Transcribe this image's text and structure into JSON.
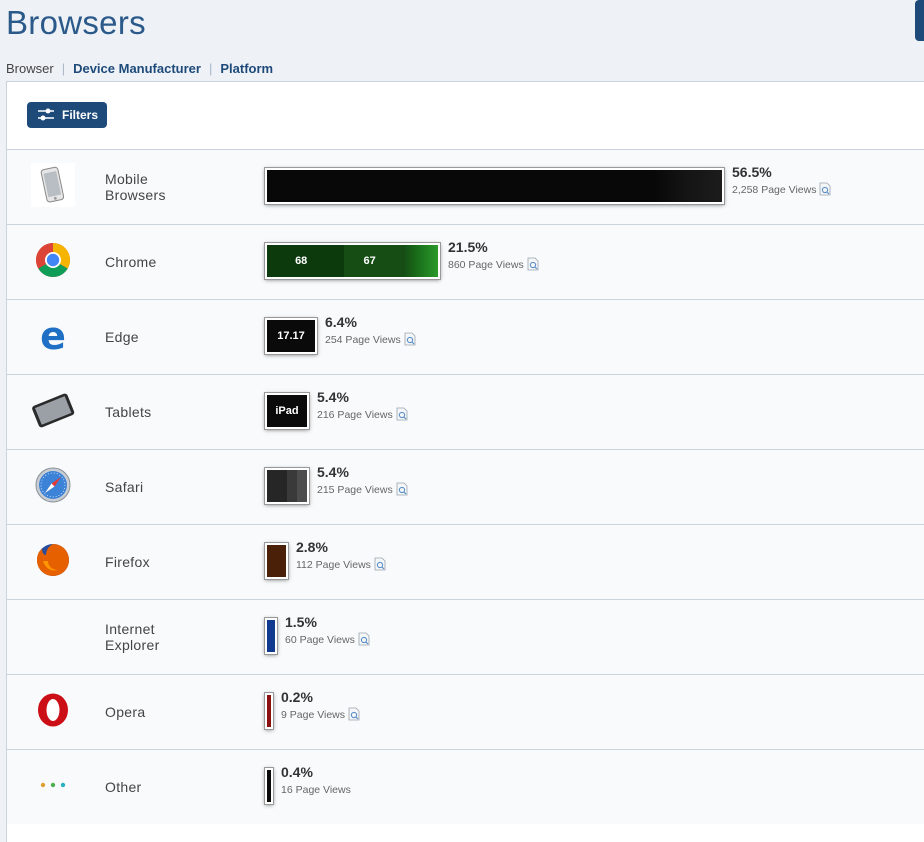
{
  "page": {
    "title": "Browsers"
  },
  "tabs": [
    {
      "label": "Browser",
      "active": true
    },
    {
      "label": "Device Manufacturer",
      "active": false
    },
    {
      "label": "Platform",
      "active": false
    }
  ],
  "filters": {
    "label": "Filters"
  },
  "rows": [
    {
      "name_lines": [
        "Mobile",
        "Browsers"
      ],
      "percent": "56.5%",
      "views": "2,258 Page Views",
      "share": 56.5,
      "icon": "mobile-phone-icon",
      "bar_color": "#0a0a0a",
      "bar_labels": [],
      "has_report_icon": true
    },
    {
      "name_lines": [
        "Chrome"
      ],
      "percent": "21.5%",
      "views": "860 Page Views",
      "share": 21.5,
      "icon": "chrome-icon",
      "bar_color": "#0b3d0b",
      "bar_labels": [
        "68",
        "67"
      ],
      "has_report_icon": true
    },
    {
      "name_lines": [
        "Edge"
      ],
      "percent": "6.4%",
      "views": "254 Page Views",
      "share": 6.4,
      "icon": "edge-icon",
      "bar_color": "#0a0a0a",
      "bar_labels": [
        "17.17"
      ],
      "has_report_icon": true
    },
    {
      "name_lines": [
        "Tablets"
      ],
      "percent": "5.4%",
      "views": "216 Page Views",
      "share": 5.4,
      "icon": "tablet-icon",
      "bar_color": "#0a0a0a",
      "bar_labels": [
        "iPad"
      ],
      "has_report_icon": true
    },
    {
      "name_lines": [
        "Safari"
      ],
      "percent": "5.4%",
      "views": "215 Page Views",
      "share": 5.4,
      "icon": "safari-icon",
      "bar_color": "#2a2a2a",
      "bar_labels": [],
      "has_report_icon": true
    },
    {
      "name_lines": [
        "Firefox"
      ],
      "percent": "2.8%",
      "views": "112 Page Views",
      "share": 2.8,
      "icon": "firefox-icon",
      "bar_color": "#4a2008",
      "bar_labels": [],
      "has_report_icon": true
    },
    {
      "name_lines": [
        "Internet",
        "Explorer"
      ],
      "percent": "1.5%",
      "views": "60 Page Views",
      "share": 1.5,
      "icon": "internet-explorer-icon",
      "bar_color": "#0f3a8f",
      "bar_labels": [],
      "has_report_icon": true
    },
    {
      "name_lines": [
        "Opera"
      ],
      "percent": "0.2%",
      "views": "9 Page Views",
      "share": 0.2,
      "icon": "opera-icon",
      "bar_color": "#8a1010",
      "bar_labels": [],
      "has_report_icon": true
    },
    {
      "name_lines": [
        "Other"
      ],
      "percent": "0.4%",
      "views": "16 Page Views",
      "share": 0.4,
      "icon": "other-dots-icon",
      "bar_color": "#0a0a0a",
      "bar_labels": [],
      "has_report_icon": false
    }
  ]
}
